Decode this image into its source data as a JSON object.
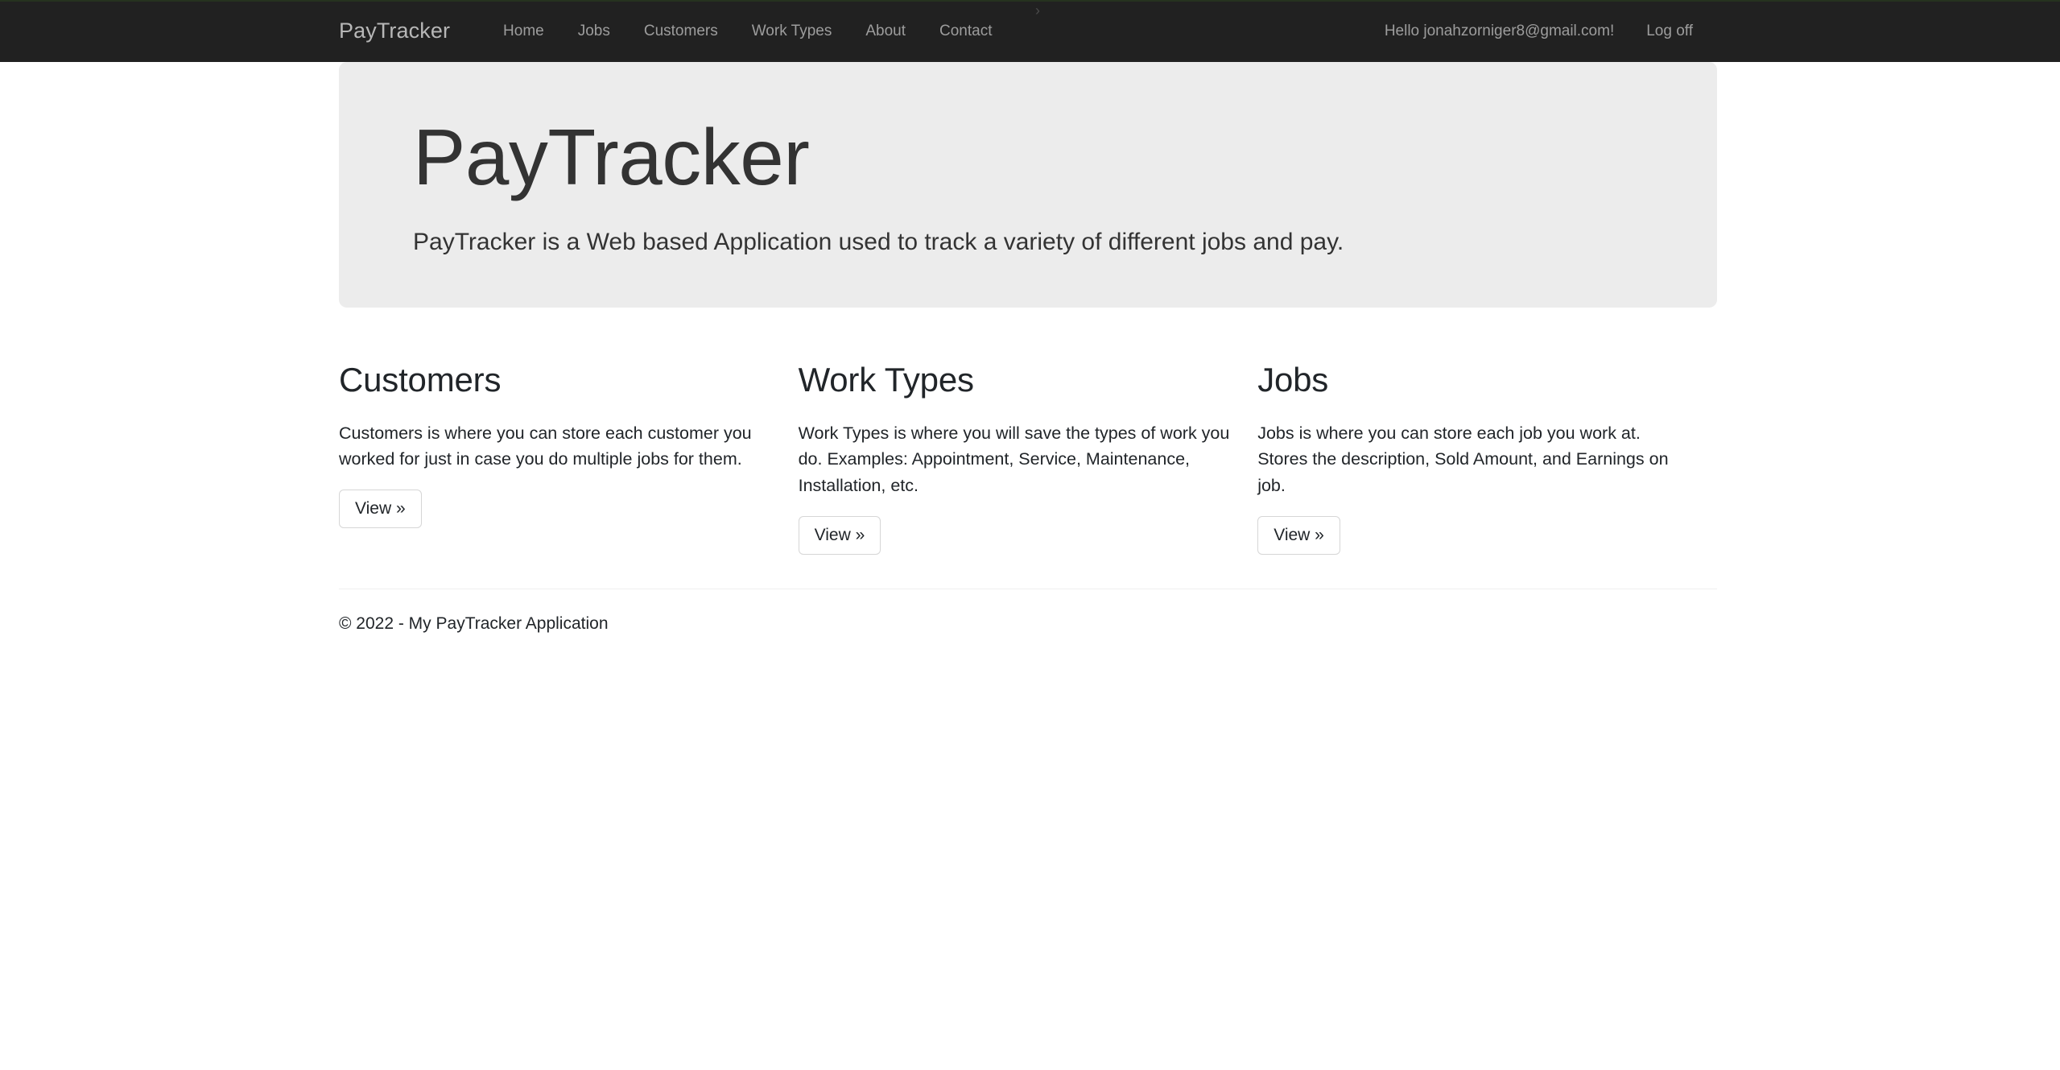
{
  "brand": {
    "name": "PayTracker"
  },
  "nav": {
    "marker_glyph": "›",
    "links": [
      {
        "label": "Home",
        "name": "nav-link-home"
      },
      {
        "label": "Jobs",
        "name": "nav-link-jobs"
      },
      {
        "label": "Customers",
        "name": "nav-link-customers"
      },
      {
        "label": "Work Types",
        "name": "nav-link-work-types"
      },
      {
        "label": "About",
        "name": "nav-link-about"
      },
      {
        "label": "Contact",
        "name": "nav-link-contact"
      }
    ],
    "greeting": "Hello jonahzorniger8@gmail.com!",
    "logoff_label": "Log off"
  },
  "hero": {
    "title": "PayTracker",
    "subtitle": "PayTracker is a Web based Application used to track a variety of different jobs and pay."
  },
  "features": [
    {
      "title": "Customers",
      "description": "Customers is where you can store each customer you worked for just in case you do multiple jobs for them.",
      "button_label": "View »"
    },
    {
      "title": "Work Types",
      "description": "Work Types is where you will save the types of work you do. Examples: Appointment, Service, Maintenance, Installation, etc.",
      "button_label": "View »"
    },
    {
      "title": "Jobs",
      "description": "Jobs is where you can store each job you work at. Stores the description, Sold Amount, and Earnings on job.",
      "button_label": "View »"
    }
  ],
  "footer": {
    "copyright": "© 2022 - My PayTracker Application"
  },
  "colors": {
    "navbar_bg": "#212121",
    "navbar_text": "#9d9d9d",
    "brand_text": "#b7b7b7",
    "jumbotron_bg": "#ececec",
    "body_text": "#212529",
    "button_border": "#d6d6d6",
    "rule": "#efefef"
  }
}
